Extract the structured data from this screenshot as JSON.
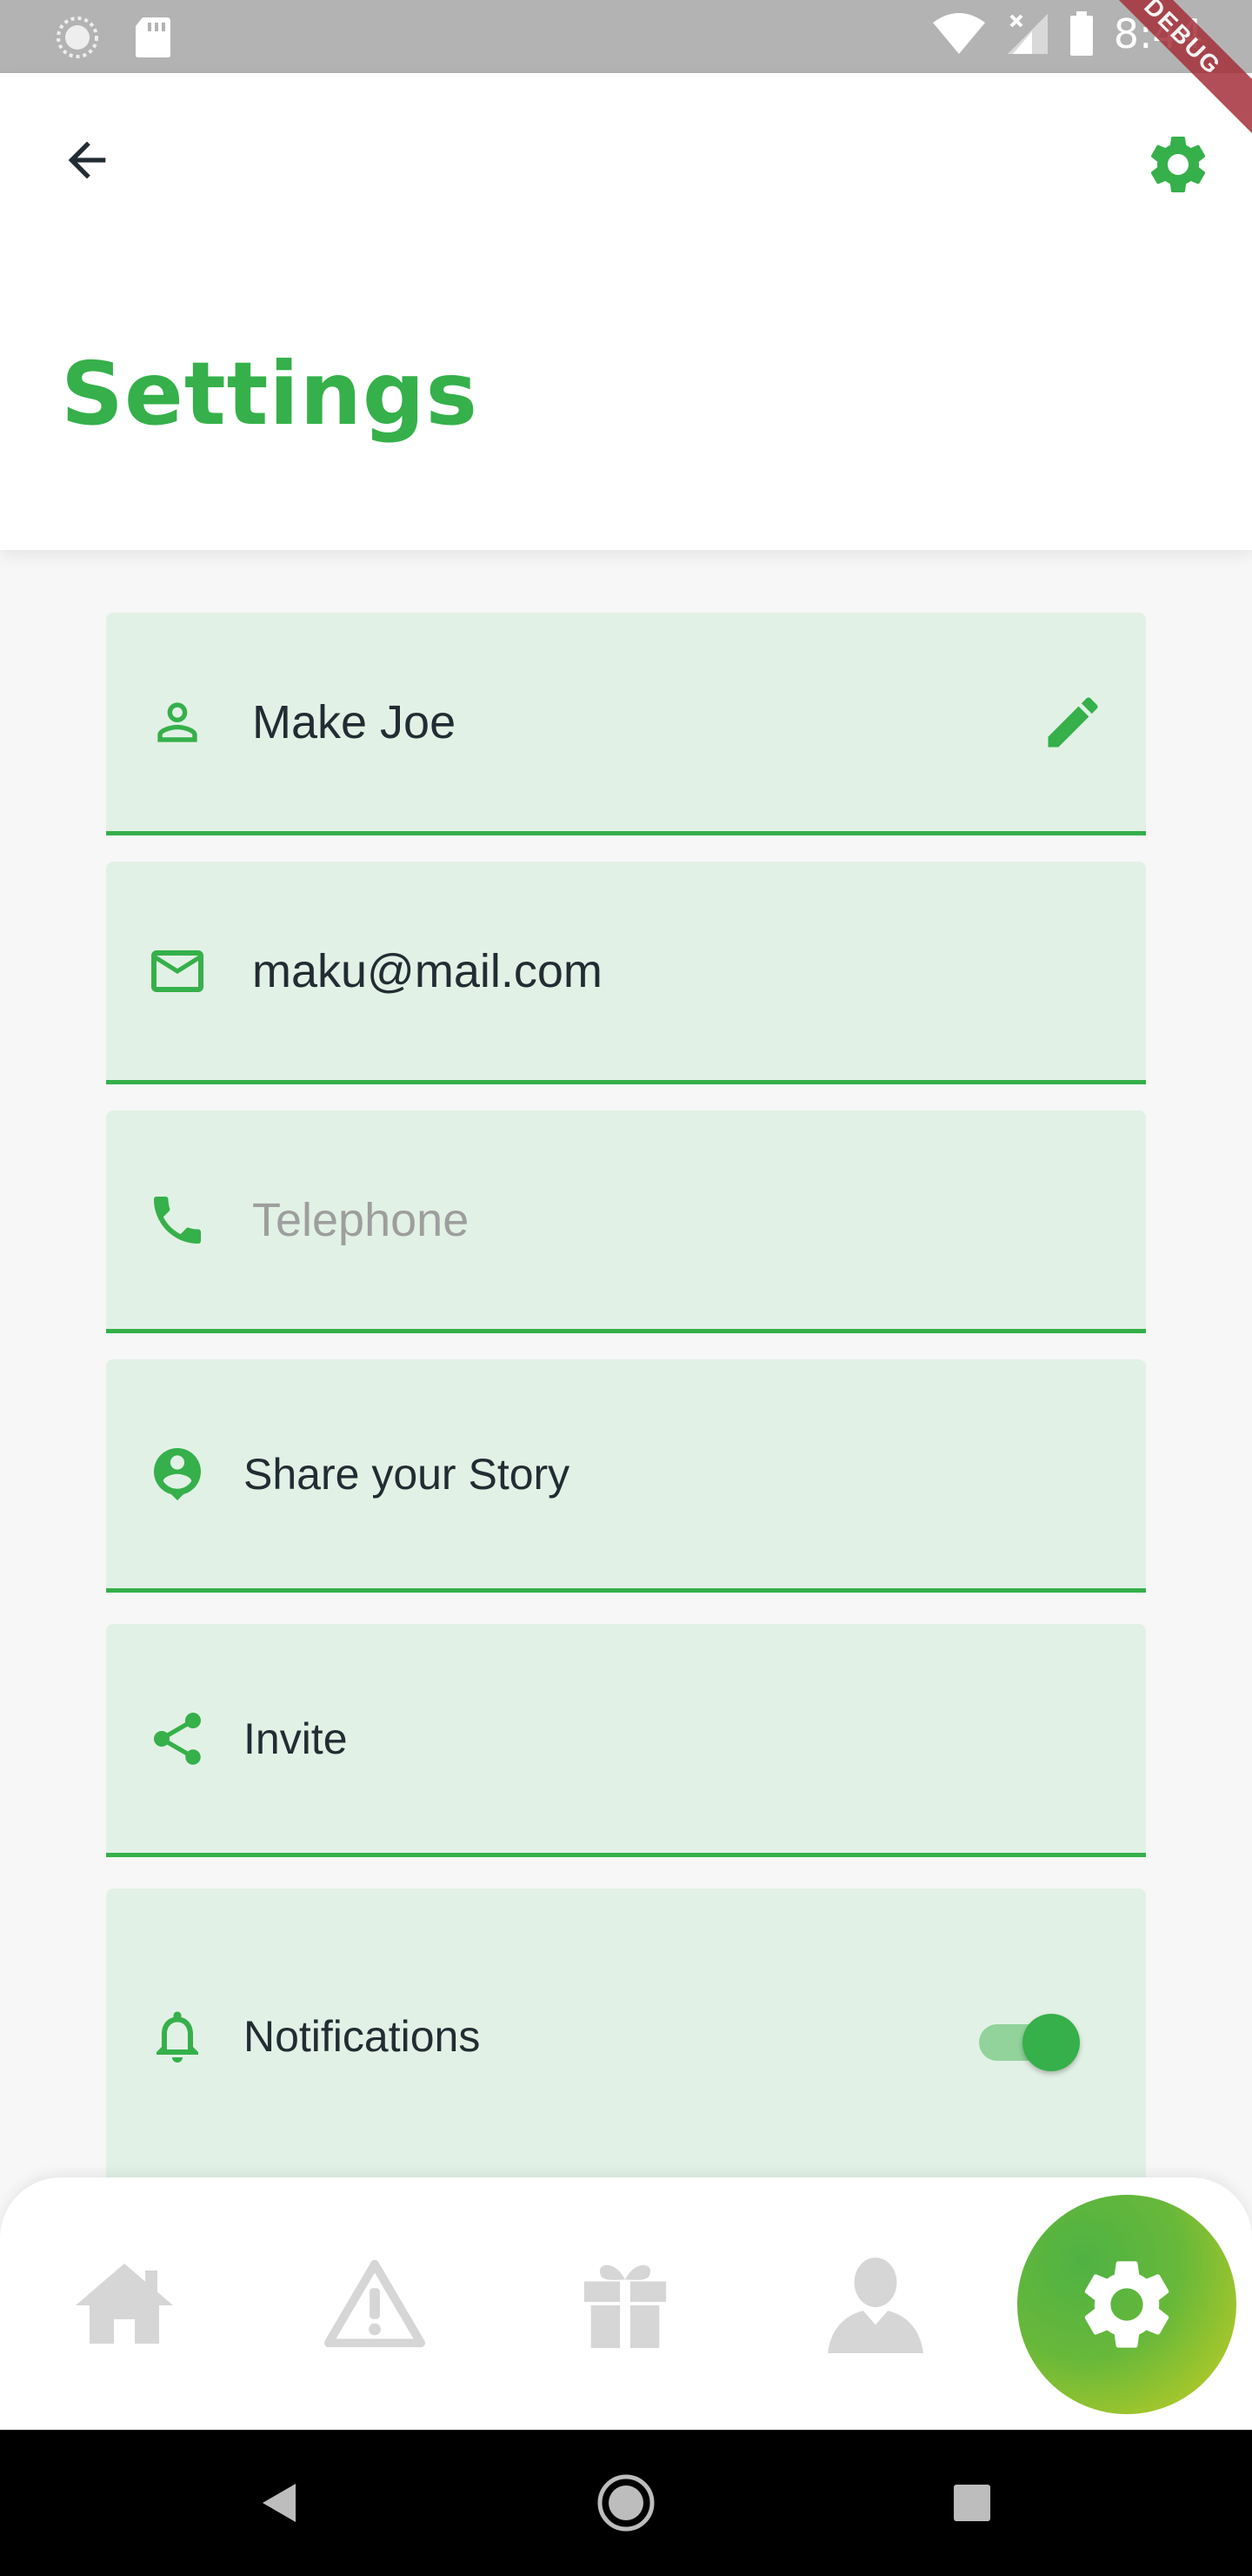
{
  "status_bar": {
    "time": "8:44"
  },
  "debug_banner": "DEBUG",
  "app_bar": {
    "title": "Settings"
  },
  "fields": {
    "name": {
      "value": "Make Joe"
    },
    "email": {
      "value": "maku@mail.com"
    },
    "phone": {
      "placeholder": "Telephone"
    }
  },
  "menu": {
    "story": "Share your Story",
    "invite": "Invite",
    "notifications": "Notifications",
    "notifications_enabled": true
  },
  "bottom_nav": {
    "items": [
      "home-icon",
      "warning-icon",
      "gift-icon",
      "person-icon",
      "gear-icon"
    ],
    "active": "gear-icon"
  },
  "colors": {
    "accent": "#35b04a",
    "row_bg": "#e2f1e5",
    "inactive_icon": "#d6d6d6"
  }
}
